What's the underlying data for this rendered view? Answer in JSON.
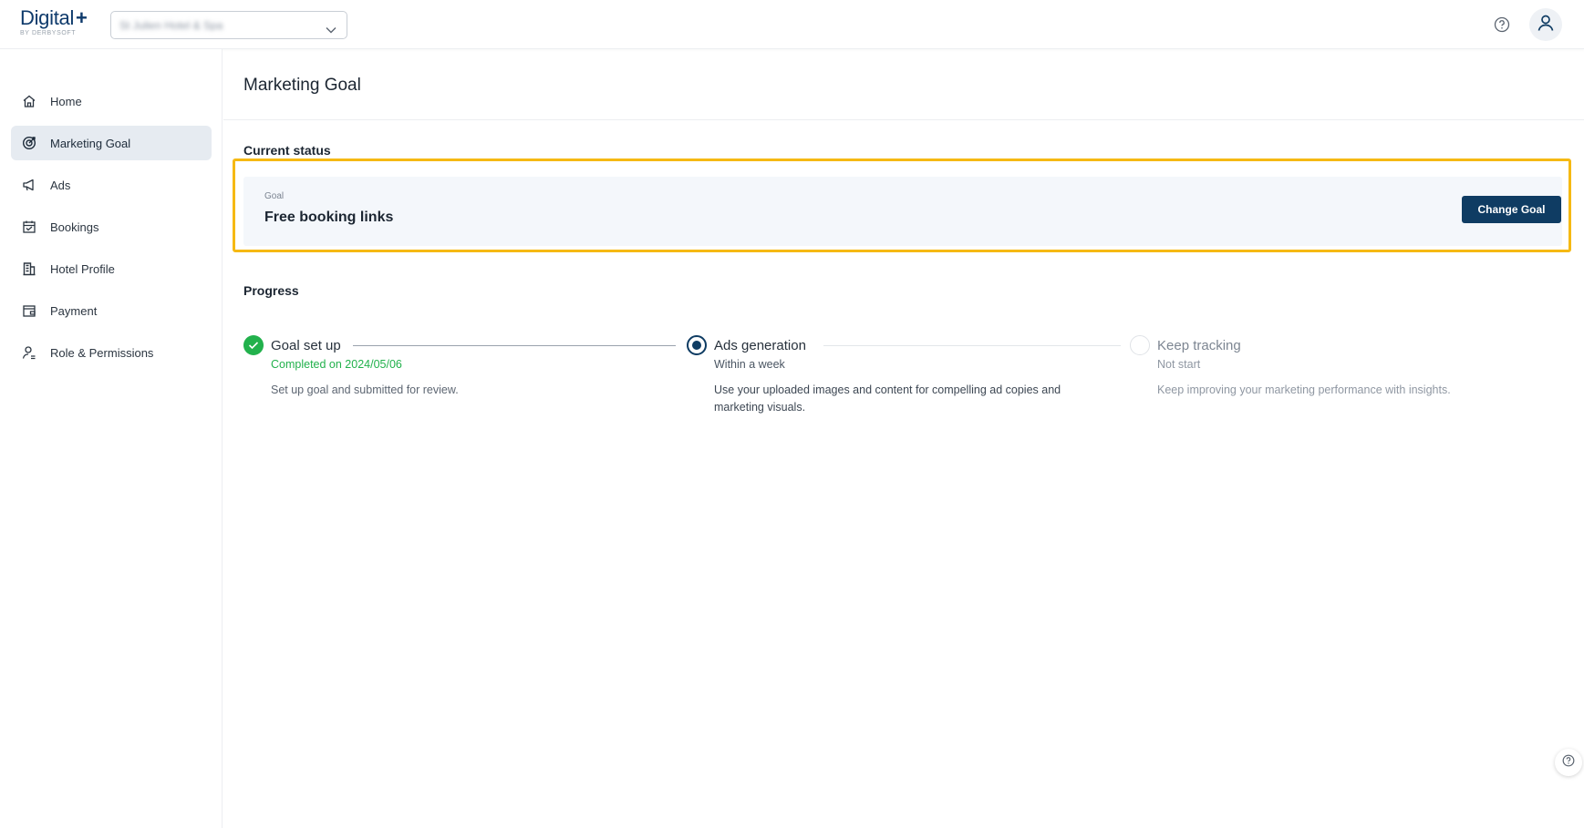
{
  "app": {
    "logo_text": "Digital",
    "logo_plus": "+",
    "logo_sub": "BY DERBYSOFT",
    "hotel_selector_value": "St Julien Hotel & Spa"
  },
  "sidebar": {
    "items": [
      {
        "label": "Home",
        "icon": "home-icon"
      },
      {
        "label": "Marketing Goal",
        "icon": "target-icon",
        "active": true
      },
      {
        "label": "Ads",
        "icon": "megaphone-icon"
      },
      {
        "label": "Bookings",
        "icon": "calendar-icon"
      },
      {
        "label": "Hotel Profile",
        "icon": "building-icon"
      },
      {
        "label": "Payment",
        "icon": "wallet-icon"
      },
      {
        "label": "Role & Permissions",
        "icon": "user-icon"
      }
    ]
  },
  "main": {
    "title": "Marketing Goal",
    "current_status_label": "Current status",
    "goal_label": "Goal",
    "goal_value": "Free booking links",
    "change_goal_button": "Change Goal",
    "progress_label": "Progress",
    "steps": [
      {
        "title": "Goal set up",
        "subtitle": "Completed on 2024/05/06",
        "description": "Set up goal and submitted for review.",
        "state": "done"
      },
      {
        "title": "Ads generation",
        "subtitle": "Within a week",
        "description": "Use your uploaded images and content for compelling ad copies and marketing visuals.",
        "state": "current"
      },
      {
        "title": "Keep tracking",
        "subtitle": "Not start",
        "description": "Keep improving your marketing performance with insights.",
        "state": "pending"
      }
    ]
  },
  "colors": {
    "brand": "#0f3c63",
    "success": "#22b14c",
    "highlight": "#f6b913",
    "active_nav_bg": "#e6ebf1"
  }
}
